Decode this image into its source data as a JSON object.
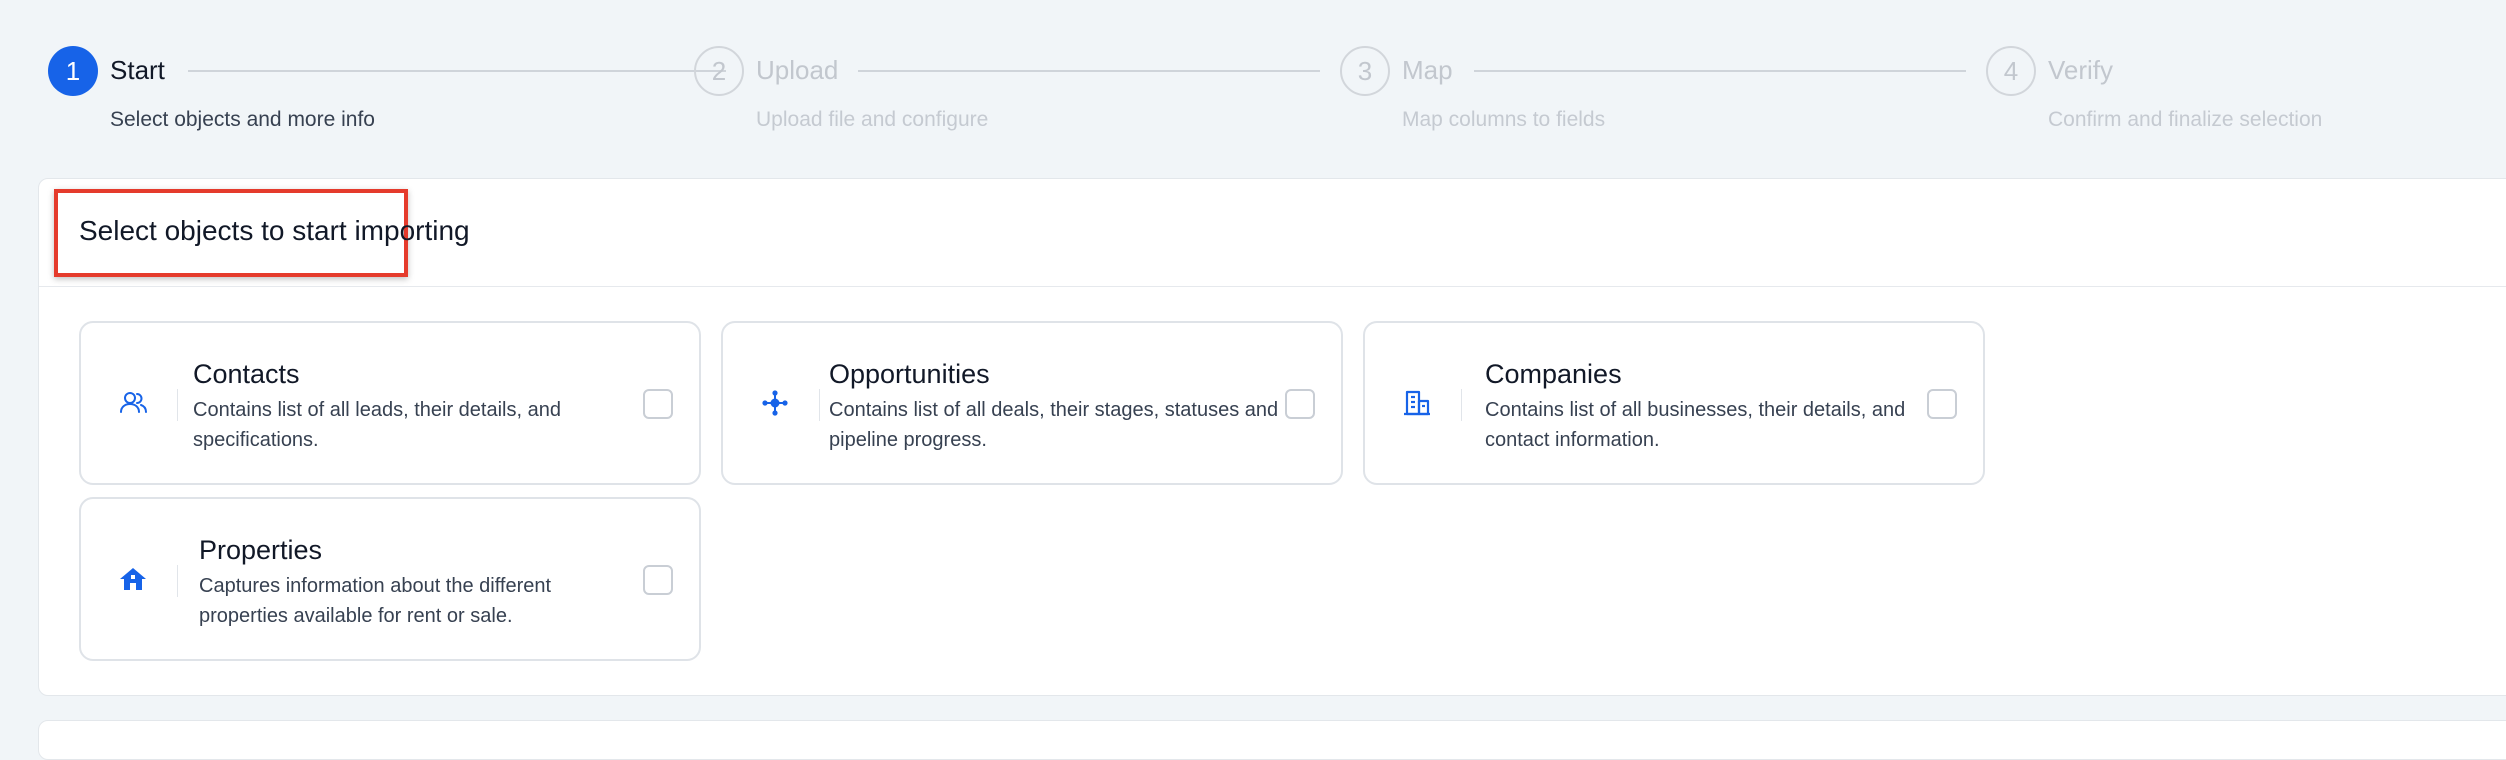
{
  "stepper": {
    "steps": [
      {
        "number": "1",
        "title": "Start",
        "subtitle": "Select objects and more info",
        "active": true
      },
      {
        "number": "2",
        "title": "Upload",
        "subtitle": "Upload file and configure",
        "active": false
      },
      {
        "number": "3",
        "title": "Map",
        "subtitle": "Map columns to fields",
        "active": false
      },
      {
        "number": "4",
        "title": "Verify",
        "subtitle": "Confirm and finalize selection",
        "active": false
      }
    ]
  },
  "panel": {
    "title": "Select objects to start importing"
  },
  "objects": [
    {
      "title": "Contacts",
      "description": "Contains list of all leads, their details, and specifications.",
      "icon": "users-icon",
      "checked": false
    },
    {
      "title": "Opportunities",
      "description": "Contains list of all deals, their stages, statuses and pipeline progress.",
      "icon": "network-icon",
      "checked": false
    },
    {
      "title": "Companies",
      "description": "Contains list of all businesses, their details, and contact information.",
      "icon": "building-icon",
      "checked": false
    },
    {
      "title": "Properties",
      "description": "Captures information about the different properties available for rent or sale.",
      "icon": "home-icon",
      "checked": false
    }
  ],
  "colors": {
    "accent": "#1763e8",
    "highlight": "#e53b2c",
    "background": "#f1f5f8"
  }
}
